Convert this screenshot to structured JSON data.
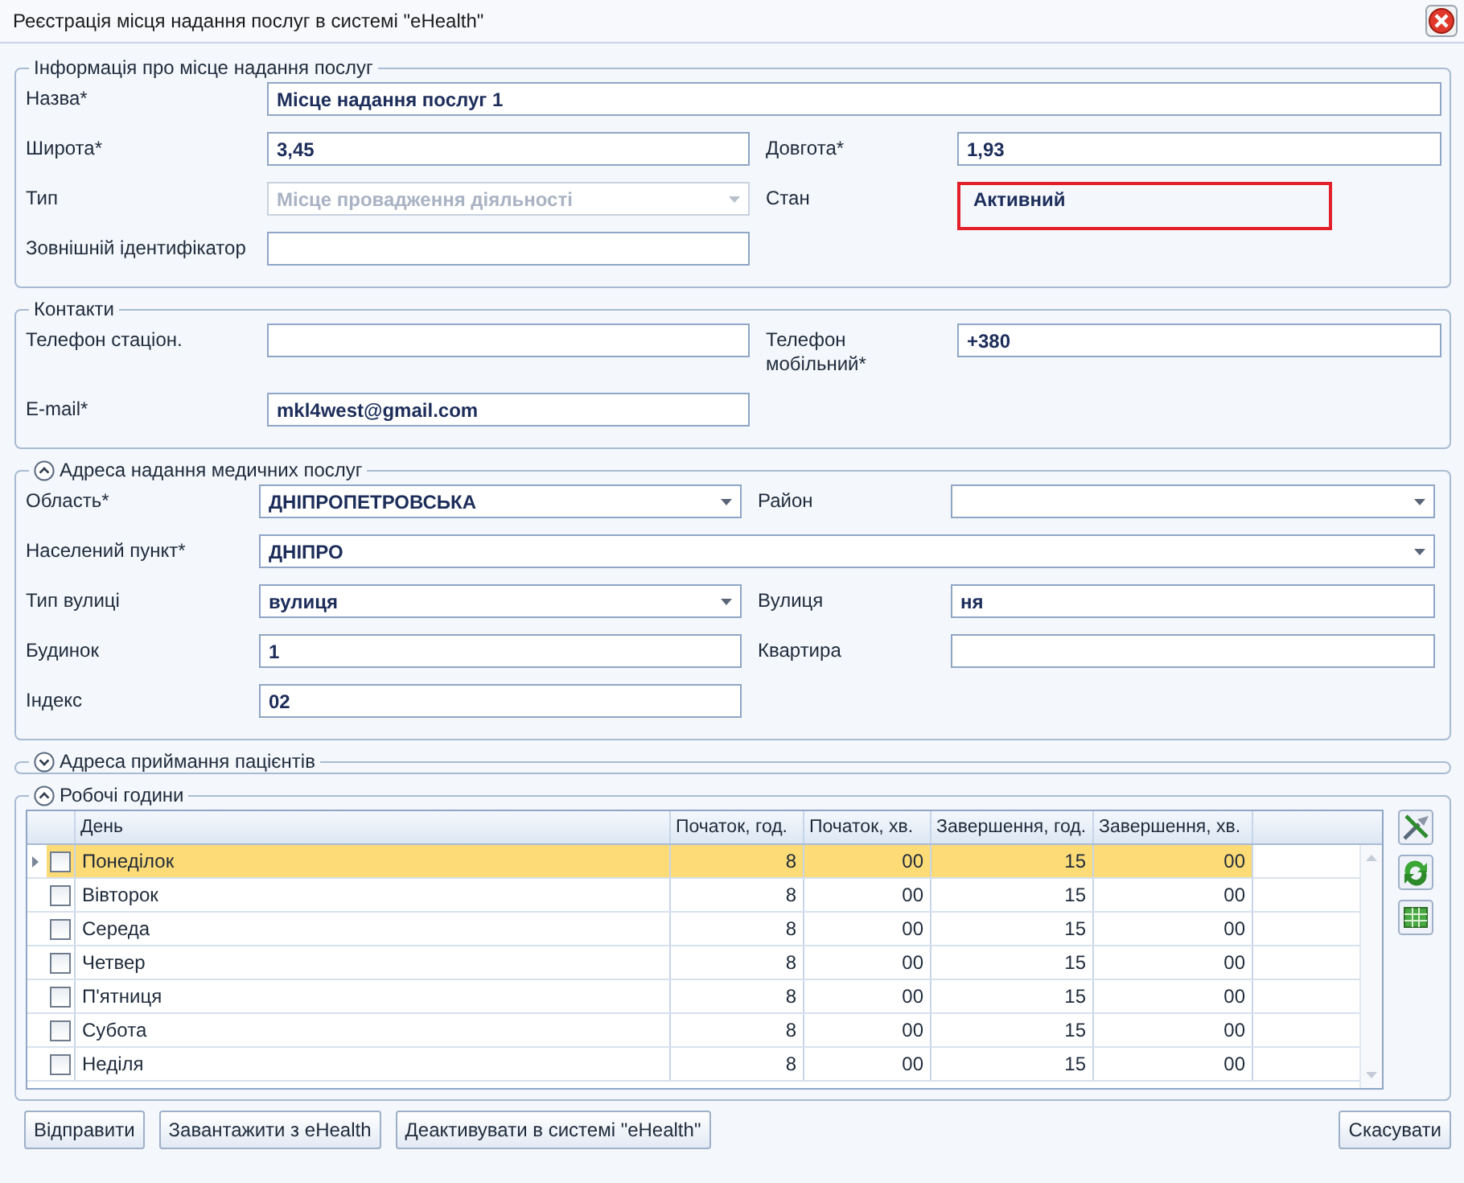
{
  "window": {
    "title": "Реєстрація місця надання послуг в системі \"eHealth\""
  },
  "form_sections": [
    {
      "title": "Інформація про місце надання послуг",
      "kind": "plain",
      "rows": [
        [
          {
            "label": "Назва*",
            "value": "Місце надання послуг 1",
            "kind": "text",
            "wide": true
          }
        ],
        [
          {
            "label": "Широта*",
            "value": "3,45",
            "kind": "text"
          },
          {
            "label": "Довгота*",
            "value": "1,93",
            "kind": "text"
          }
        ],
        [
          {
            "label": "Тип",
            "value": "Місце провадження діяльності",
            "kind": "combo",
            "disabled": true
          },
          {
            "label": "Стан",
            "value": "Активний",
            "kind": "status"
          }
        ],
        [
          {
            "label": "Зовнішній ідентифікатор",
            "kind": "text"
          }
        ]
      ]
    },
    {
      "title": "Контакти",
      "kind": "plain",
      "rows": [
        [
          {
            "label": "Телефон стаціон.",
            "kind": "text"
          },
          {
            "label": "Телефон мобільний*",
            "value": "+380",
            "kind": "text"
          }
        ],
        [
          {
            "label": "E-mail*",
            "value": "mkl4west@gmail.com",
            "kind": "text"
          }
        ]
      ]
    },
    {
      "title": "Адреса надання медичних послуг",
      "kind": "collapsible",
      "expanded": true,
      "rows": [
        [
          {
            "label": "Область*",
            "value": "ДНІПРОПЕТРОВСЬКА",
            "kind": "combo"
          },
          {
            "label": "Район",
            "kind": "combo"
          }
        ],
        [
          {
            "label": "Населений пункт*",
            "value": "ДНІПРО",
            "kind": "combo",
            "wide": true
          }
        ],
        [
          {
            "label": "Тип вулиці",
            "value": "вулиця",
            "kind": "combo"
          },
          {
            "label": "Вулиця",
            "value": "ня",
            "kind": "text"
          }
        ],
        [
          {
            "label": "Будинок",
            "value": "1",
            "kind": "text"
          },
          {
            "label": "Квартира",
            "kind": "text"
          }
        ],
        [
          {
            "label": "Індекс",
            "value": "02",
            "kind": "text"
          }
        ]
      ]
    },
    {
      "title": "Адреса приймання пацієнтів",
      "kind": "collapsible",
      "expanded": false
    }
  ],
  "working_hours": {
    "title": "Робочі години",
    "expanded": true,
    "columns": [
      "День",
      "Початок, год.",
      "Початок, хв.",
      "Завершення, год.",
      "Завершення, хв."
    ],
    "rows": [
      {
        "cells": [
          "Понеділок",
          "8",
          "00",
          "15",
          "00"
        ],
        "checked": false,
        "selected": true
      },
      {
        "cells": [
          "Вівторок",
          "8",
          "00",
          "15",
          "00"
        ],
        "checked": false,
        "selected": false
      },
      {
        "cells": [
          "Середа",
          "8",
          "00",
          "15",
          "00"
        ],
        "checked": false,
        "selected": false
      },
      {
        "cells": [
          "Четвер",
          "8",
          "00",
          "15",
          "00"
        ],
        "checked": false,
        "selected": false
      },
      {
        "cells": [
          "П'ятниця",
          "8",
          "00",
          "15",
          "00"
        ],
        "checked": false,
        "selected": false
      },
      {
        "cells": [
          "Субота",
          "8",
          "00",
          "15",
          "00"
        ],
        "checked": false,
        "selected": false
      },
      {
        "cells": [
          "Неділя",
          "8",
          "00",
          "15",
          "00"
        ],
        "checked": false,
        "selected": false
      }
    ]
  },
  "footer": {
    "left_buttons": [
      "Відправити",
      "Завантажити з eHealth",
      "Деактивувати в системі \"eHealth\""
    ],
    "right_buttons": [
      "Скасувати"
    ]
  }
}
